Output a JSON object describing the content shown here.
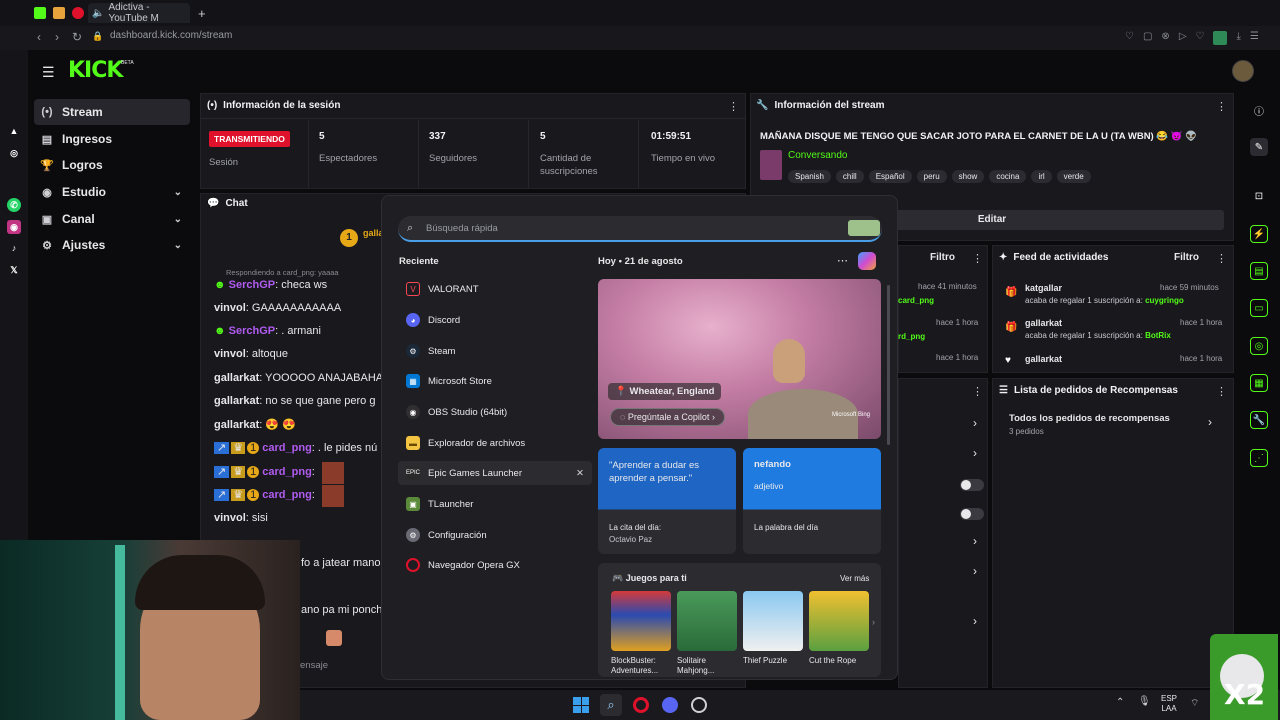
{
  "browser": {
    "tab_title": "Adictiva - YouTube M",
    "url": "dashboard.kick.com/stream",
    "new_tab": "+"
  },
  "kick": {
    "logo": "KICK",
    "logo_badge": "BETA",
    "nav": [
      {
        "label": "Stream",
        "icon": "stream-icon"
      },
      {
        "label": "Ingresos",
        "icon": "money-icon"
      },
      {
        "label": "Logros",
        "icon": "trophy-icon"
      },
      {
        "label": "Estudio",
        "icon": "studio-icon"
      },
      {
        "label": "Canal",
        "icon": "channel-icon"
      },
      {
        "label": "Ajustes",
        "icon": "gear-icon"
      }
    ]
  },
  "session": {
    "title": "Información de la sesión",
    "live_badge": "TRANSMITIENDO",
    "session_label": "Sesión",
    "stats": [
      {
        "value": "5",
        "label": "Espectadores"
      },
      {
        "value": "337",
        "label": "Seguidores"
      },
      {
        "value": "5",
        "label": "Cantidad de suscripciones"
      },
      {
        "value": "01:59:51",
        "label": "Tiempo en vivo"
      }
    ]
  },
  "stream_info": {
    "title": "Información del stream",
    "stream_title": "MAÑANA DISQUE ME TENGO QUE SACAR JOTO PARA EL CARNET DE LA U (TA WBN) 😂 😈 👽",
    "category": "Conversando",
    "tags": [
      "Spanish",
      "chill",
      "Español",
      "peru",
      "show",
      "cocina",
      "irl",
      "verde"
    ],
    "edit_button": "Editar"
  },
  "chat": {
    "title": "Chat",
    "reply_hint": "Respondiendo a card_png: yaaaa",
    "messages": [
      {
        "user": "SerchGP",
        "text": ": checa ws",
        "color": "#b15cf0"
      },
      {
        "user": "vinvol",
        "text": ": GAAAAAAAAAAA",
        "color": "#ffffff"
      },
      {
        "user": "SerchGP",
        "text": ": . armani",
        "color": "#b15cf0"
      },
      {
        "user": "vinvol",
        "text": ": altoque",
        "color": "#ffffff"
      },
      {
        "user": "gallarkat",
        "text": ": YOOOOO ANAJABAHA",
        "color": "#ffffff"
      },
      {
        "user": "gallarkat",
        "text": ": no se que gane pero g",
        "color": "#ffffff"
      },
      {
        "user": "gallarkat",
        "text": ": 😍 😍",
        "color": "#ffffff"
      },
      {
        "user": "card_png",
        "text": ": . le pides nú",
        "color": "#b15cf0"
      },
      {
        "user": "card_png",
        "text": ":",
        "color": "#b15cf0"
      },
      {
        "user": "card_png",
        "text": ":",
        "color": "#b15cf0"
      },
      {
        "user": "vinvol",
        "text": ": sisi",
        "color": "#ffffff"
      }
    ],
    "partial_lines": [
      "fo a jatear mano",
      "ano pa mi ponch"
    ],
    "input_placeholder": "ensaje",
    "pinned_user": "galla"
  },
  "activity": {
    "title": "Feed de actividades",
    "filter": "Filtro",
    "items": [
      {
        "user": "katgallar",
        "time": "hace 59 minutos",
        "text": "acaba de regalar 1 suscripción a: ",
        "target": "cuygringo"
      },
      {
        "user": "gallarkat",
        "time": "hace 1 hora",
        "text": "acaba de regalar 1 suscripción a: ",
        "target": "BotRix"
      },
      {
        "user": "gallarkat",
        "time": "hace 1 hora",
        "text": "",
        "target": ""
      }
    ]
  },
  "mid_feed": {
    "filter": "Filtro",
    "items": [
      {
        "time": "hace 41 minutos",
        "target": "card_png"
      },
      {
        "time": "hace 1 hora",
        "target": "rd_png"
      },
      {
        "time": "hace 1 hora",
        "target": ""
      }
    ]
  },
  "rewards": {
    "title": "Lista de pedidos de Recompensas",
    "all": "Todos los pedidos de recompensas",
    "count": "3 pedidos"
  },
  "start_menu": {
    "search_placeholder": "Búsqueda rápida",
    "recent_title": "Reciente",
    "recent": [
      {
        "label": "VALORANT",
        "icon": "valorant-icon",
        "color": "#ff4655"
      },
      {
        "label": "Discord",
        "icon": "discord-icon",
        "color": "#5865f2"
      },
      {
        "label": "Steam",
        "icon": "steam-icon",
        "color": "#1b2838"
      },
      {
        "label": "Microsoft Store",
        "icon": "store-icon",
        "color": "#0078d4"
      },
      {
        "label": "OBS Studio (64bit)",
        "icon": "obs-icon",
        "color": "#302e31"
      },
      {
        "label": "Explorador de archivos",
        "icon": "folder-icon",
        "color": "#f4c542"
      },
      {
        "label": "Epic Games Launcher",
        "icon": "epic-icon",
        "color": "#2a2a2a"
      },
      {
        "label": "TLauncher",
        "icon": "tlauncher-icon",
        "color": "#5a8a3a"
      },
      {
        "label": "Configuración",
        "icon": "settings-icon",
        "color": "#6a6a75"
      },
      {
        "label": "Navegador Opera GX",
        "icon": "opera-icon",
        "color": "#e0112b"
      }
    ],
    "today_label": "Hoy",
    "date": "21 de agosto",
    "location": "Wheatear, England",
    "copilot": "Pregúntale a Copilot",
    "bing": "Microsoft Bing",
    "quote": "\"Aprender a dudar es aprender a pensar.\"",
    "quote_label": "La cita del día:",
    "quote_author": "Octavio Paz",
    "word": "nefando",
    "word_type": "adjetivo",
    "word_label": "La palabra del día",
    "games_title": "Juegos para ti",
    "see_more": "Ver más",
    "games": [
      {
        "name": "BlockBuster: Adventures...",
        "color": "#2a4bb0"
      },
      {
        "name": "Solitaire Mahjong...",
        "color": "#3c8a4a"
      },
      {
        "name": "Thief Puzzle",
        "color": "#6fb0e0"
      },
      {
        "name": "Cut the Rope",
        "color": "#e0a020"
      }
    ]
  },
  "taskbar": {
    "lang": "ESP",
    "lang2": "LAA"
  },
  "overlay": {
    "x2": "X2"
  }
}
